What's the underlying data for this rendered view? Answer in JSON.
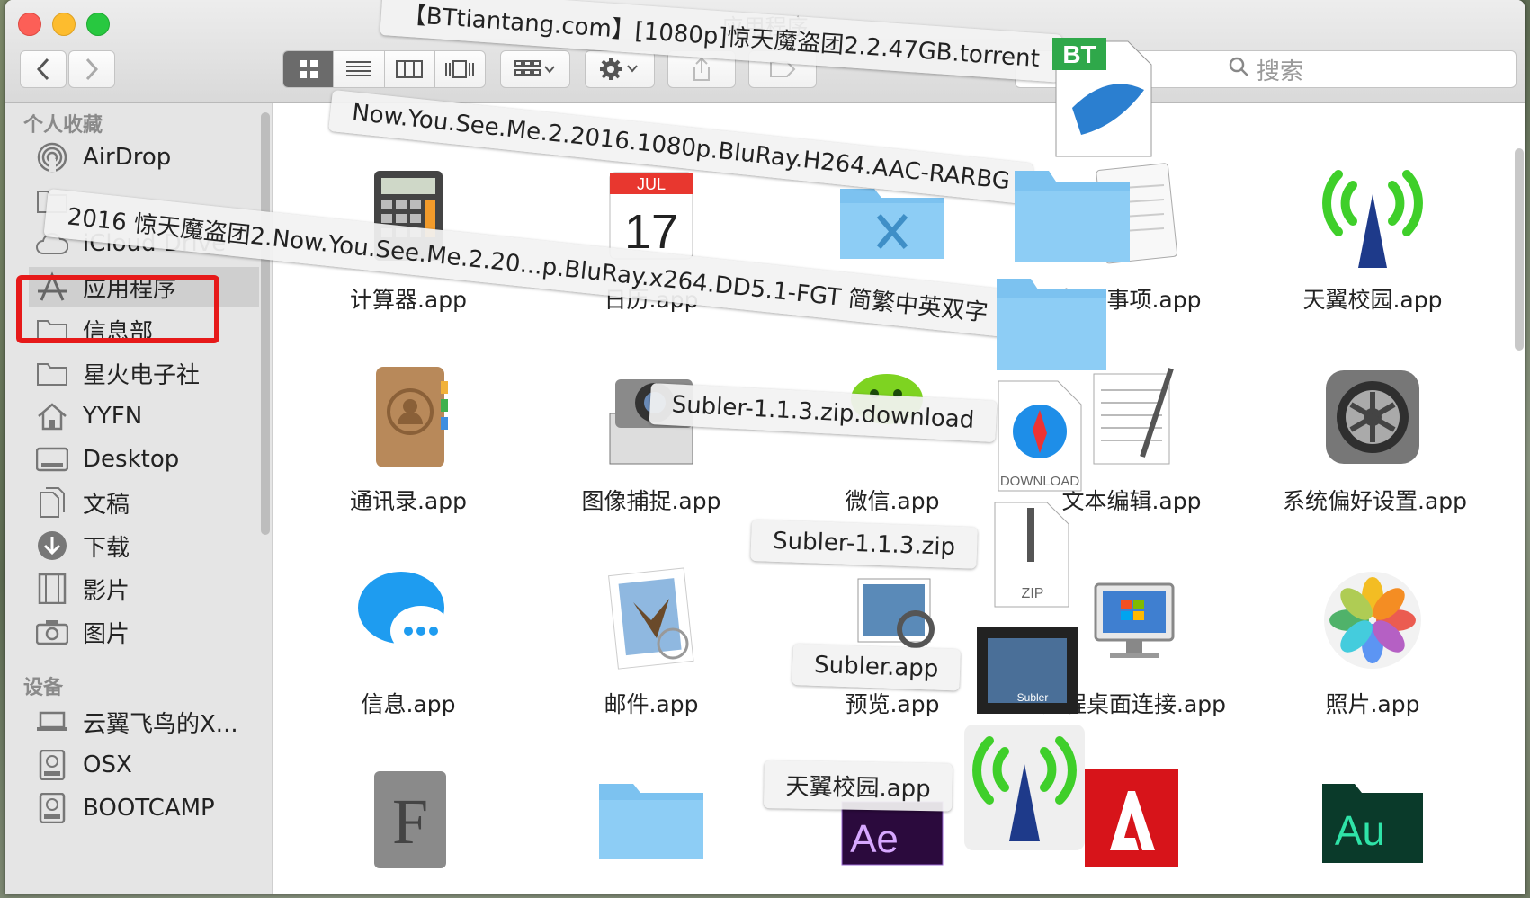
{
  "window": {
    "title": "应用程序"
  },
  "toolbar": {
    "search_placeholder": "搜索"
  },
  "sidebar": {
    "favorites_header": "个人收藏",
    "items": [
      {
        "label": "AirDrop",
        "icon": "airdrop-icon"
      },
      {
        "label": "",
        "icon": "folder-icon"
      },
      {
        "label": "iCloud Drive",
        "icon": "cloud-icon"
      },
      {
        "label": "应用程序",
        "icon": "applications-icon",
        "selected": true
      },
      {
        "label": "信息部",
        "icon": "folder-icon"
      },
      {
        "label": "星火电子社",
        "icon": "folder-icon"
      },
      {
        "label": "YYFN",
        "icon": "home-icon"
      },
      {
        "label": "Desktop",
        "icon": "desktop-icon"
      },
      {
        "label": "文稿",
        "icon": "documents-icon"
      },
      {
        "label": "下载",
        "icon": "downloads-icon"
      },
      {
        "label": "影片",
        "icon": "movies-icon"
      },
      {
        "label": "图片",
        "icon": "camera-icon"
      }
    ],
    "devices_header": "设备",
    "devices": [
      {
        "label": "云翼飞鸟的X...",
        "icon": "laptop-icon"
      },
      {
        "label": "OSX",
        "icon": "disk-icon"
      },
      {
        "label": "BOOTCAMP",
        "icon": "disk-icon"
      }
    ]
  },
  "apps": [
    {
      "label": "计算器.app",
      "icon": "calculator-icon"
    },
    {
      "label": "日历.app",
      "icon": "calendar-icon",
      "day": "17",
      "month": "JUL"
    },
    {
      "label": "",
      "icon": "utilities-folder-icon"
    },
    {
      "label": "提醒事项.app",
      "icon": "reminders-icon"
    },
    {
      "label": "天翼校园.app",
      "icon": "tianyi-icon"
    },
    {
      "label": "通讯录.app",
      "icon": "contacts-icon"
    },
    {
      "label": "图像捕捉.app",
      "icon": "image-capture-icon"
    },
    {
      "label": "微信.app",
      "icon": "wechat-icon"
    },
    {
      "label": "文本编辑.app",
      "icon": "textedit-icon"
    },
    {
      "label": "系统偏好设置.app",
      "icon": "system-preferences-icon"
    },
    {
      "label": "信息.app",
      "icon": "messages-icon"
    },
    {
      "label": "邮件.app",
      "icon": "mail-icon"
    },
    {
      "label": "预览.app",
      "icon": "preview-icon"
    },
    {
      "label": "远程桌面连接.app",
      "icon": "remote-desktop-icon"
    },
    {
      "label": "照片.app",
      "icon": "photos-icon"
    },
    {
      "label": "",
      "icon": "font-book-icon"
    },
    {
      "label": "",
      "icon": "folder-icon"
    },
    {
      "label": "",
      "icon": "after-effects-icon",
      "text": "Ae"
    },
    {
      "label": "",
      "icon": "adobe-icon"
    },
    {
      "label": "",
      "icon": "audition-icon",
      "text": "Au"
    }
  ],
  "drag_items": [
    {
      "label": "【BTtiantang.com】[1080p]惊天魔盗团2.2.47GB.torrent"
    },
    {
      "label": "Now.You.See.Me.2.2016.1080p.BluRay.H264.AAC-RARBG"
    },
    {
      "label": "2016 惊天魔盗团2.Now.You.See.Me.2.20...p.BluRay.x264.DD5.1-FGT 简繁中英双字"
    },
    {
      "label": "Subler-1.1.3.zip.download"
    },
    {
      "label": "Subler-1.1.3.zip"
    },
    {
      "label": "Subler.app"
    },
    {
      "label": "天翼校园.app"
    }
  ],
  "drag_icons": {
    "bt": "BT",
    "download": "DOWNLOAD",
    "zip": "ZIP",
    "subler": "Subler"
  },
  "colors": {
    "highlight": "#e61919",
    "selection": "#cfcfcf",
    "folder": "#7cc2f0"
  }
}
